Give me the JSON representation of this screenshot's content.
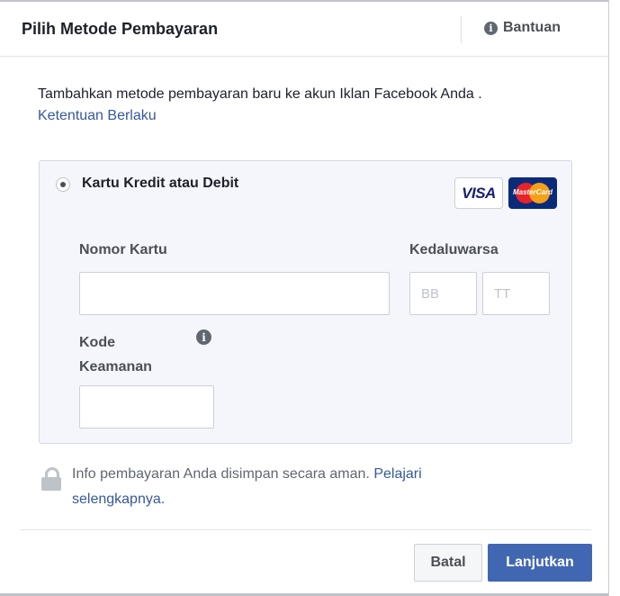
{
  "dialog": {
    "title": "Pilih Metode Pembayaran",
    "help_label": "Bantuan",
    "help_icon": "info-icon"
  },
  "intro": {
    "text": "Tambahkan metode pembayaran baru ke akun Iklan Facebook Anda .",
    "terms_link": "Ketentuan Berlaku"
  },
  "payment_option": {
    "label": "Kartu Kredit atau Debit",
    "selected": true,
    "card_brands": [
      "VISA",
      "MasterCard"
    ]
  },
  "form": {
    "card_number_label": "Nomor Kartu",
    "card_number_value": "",
    "expiry_label": "Kedaluwarsa",
    "month_placeholder": "BB",
    "year_placeholder": "TT",
    "security_code_label_line1": "Kode",
    "security_code_label_line2": "Keamanan",
    "security_code_value": ""
  },
  "secure_note": {
    "text": "Info pembayaran Anda disimpan secara aman.",
    "learn_more_part1": "Pelajari",
    "learn_more_part2": "selengkapnya."
  },
  "footer": {
    "cancel_label": "Batal",
    "continue_label": "Lanjutkan"
  },
  "colors": {
    "primary": "#4267b2",
    "link": "#365899",
    "panel_bg": "#f5f6fb"
  }
}
